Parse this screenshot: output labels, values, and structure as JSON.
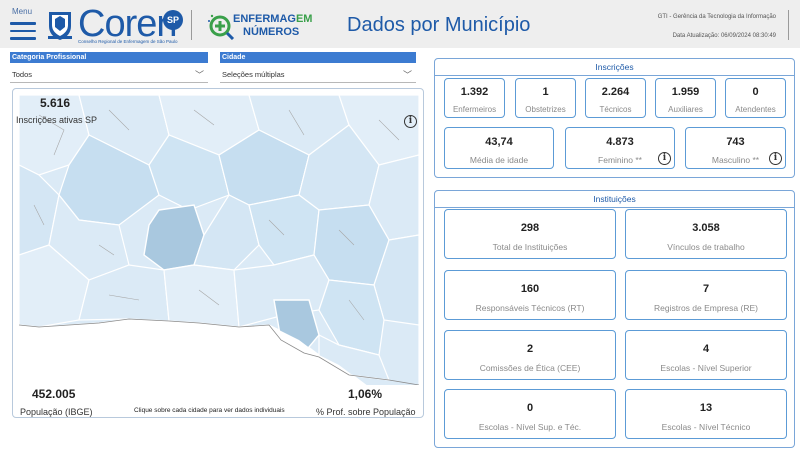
{
  "header": {
    "menu_label": "Menu",
    "brand": "Coren",
    "brand_badge": "SP",
    "brand_subtitle": "Conselho Regional de Enfermagem de São Paulo",
    "enf_top_a": "ENFERMAG",
    "enf_top_b": "EM",
    "enf_bottom": "NÚMEROS",
    "title": "Dados por Município",
    "gti": "GTI - Gerência da Tecnologia da Informação",
    "updated": "Data Atualização: 06/09/2024 08:30:49"
  },
  "filters": {
    "categoria_label": "Categoria Profissional",
    "categoria_value": "Todos",
    "cidade_label": "Cidade",
    "cidade_value": "Seleções múltiplas"
  },
  "map": {
    "inscricoes_value": "5.616",
    "inscricoes_label": "Inscrições ativas SP",
    "populacao_value": "452.005",
    "populacao_label": "População (IBGE)",
    "hint": "Clique sobre cada cidade para ver dados individuais",
    "pct_value": "1,06%",
    "pct_label": "% Prof. sobre População"
  },
  "inscricoes": {
    "title": "Inscrições",
    "cards": [
      {
        "value": "1.392",
        "label": "Enfermeiros"
      },
      {
        "value": "1",
        "label": "Obstetrizes"
      },
      {
        "value": "2.264",
        "label": "Técnicos"
      },
      {
        "value": "1.959",
        "label": "Auxiliares"
      },
      {
        "value": "0",
        "label": "Atendentes"
      }
    ],
    "stats": [
      {
        "value": "43,74",
        "label": "Média de idade"
      },
      {
        "value": "4.873",
        "label": "Feminino **"
      },
      {
        "value": "743",
        "label": "Masculino **"
      }
    ]
  },
  "instituicoes": {
    "title": "Instituições",
    "cards": [
      {
        "value": "298",
        "label": "Total de Instituições"
      },
      {
        "value": "3.058",
        "label": "Vínculos de trabalho"
      },
      {
        "value": "160",
        "label": "Responsáveis Técnicos (RT)"
      },
      {
        "value": "7",
        "label": "Registros de Empresa (RE)"
      },
      {
        "value": "2",
        "label": "Comissões de Ética (CEE)"
      },
      {
        "value": "4",
        "label": "Escolas - Nível Superior"
      },
      {
        "value": "0",
        "label": "Escolas - Nível Sup. e Téc."
      },
      {
        "value": "13",
        "label": "Escolas - Nível Técnico"
      }
    ]
  },
  "icons": {
    "menu": "hamburger-icon",
    "info": "info-icon",
    "chevron": "chevron-down-icon"
  },
  "colors": {
    "brand_blue": "#1e5aa8",
    "filter_blue": "#3c7bd1",
    "card_border": "#5c9bd6",
    "map_light": "#dbeaf6",
    "map_mid": "#c6def0",
    "map_selected": "#a9c8df"
  }
}
